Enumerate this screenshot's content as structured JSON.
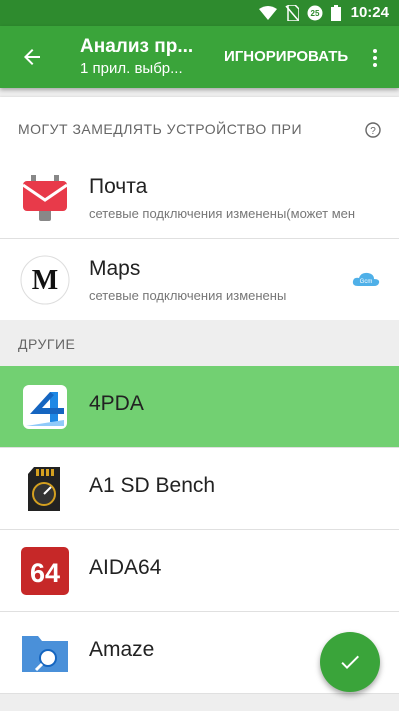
{
  "status": {
    "time": "10:24",
    "notif_count": "25"
  },
  "appbar": {
    "title": "Анализ пр...",
    "subtitle": "1 прил. выбр...",
    "ignore_label": "ИГНОРИРОВАТЬ"
  },
  "section_slow": {
    "header": "МОГУТ ЗАМЕДЛЯТЬ УСТРОЙСТВО ПРИ",
    "items": [
      {
        "name": "Почта",
        "desc": "сетевые подключения изменены(может мен",
        "icon": "mail-icon"
      },
      {
        "name": "Maps",
        "desc": "сетевые подключения изменены",
        "icon": "maps-icon"
      }
    ]
  },
  "section_other": {
    "header": "ДРУГИЕ",
    "items": [
      {
        "name": "4PDA",
        "icon": "4pda-icon",
        "selected": true
      },
      {
        "name": "A1 SD Bench",
        "icon": "sd-card-icon"
      },
      {
        "name": "AIDA64",
        "icon": "aida64-icon"
      },
      {
        "name": "Amaze",
        "icon": "folder-search-icon"
      }
    ]
  },
  "colors": {
    "primary": "#3aa43a",
    "status_bar": "#2e8b2e",
    "selected_row": "#72d072"
  }
}
